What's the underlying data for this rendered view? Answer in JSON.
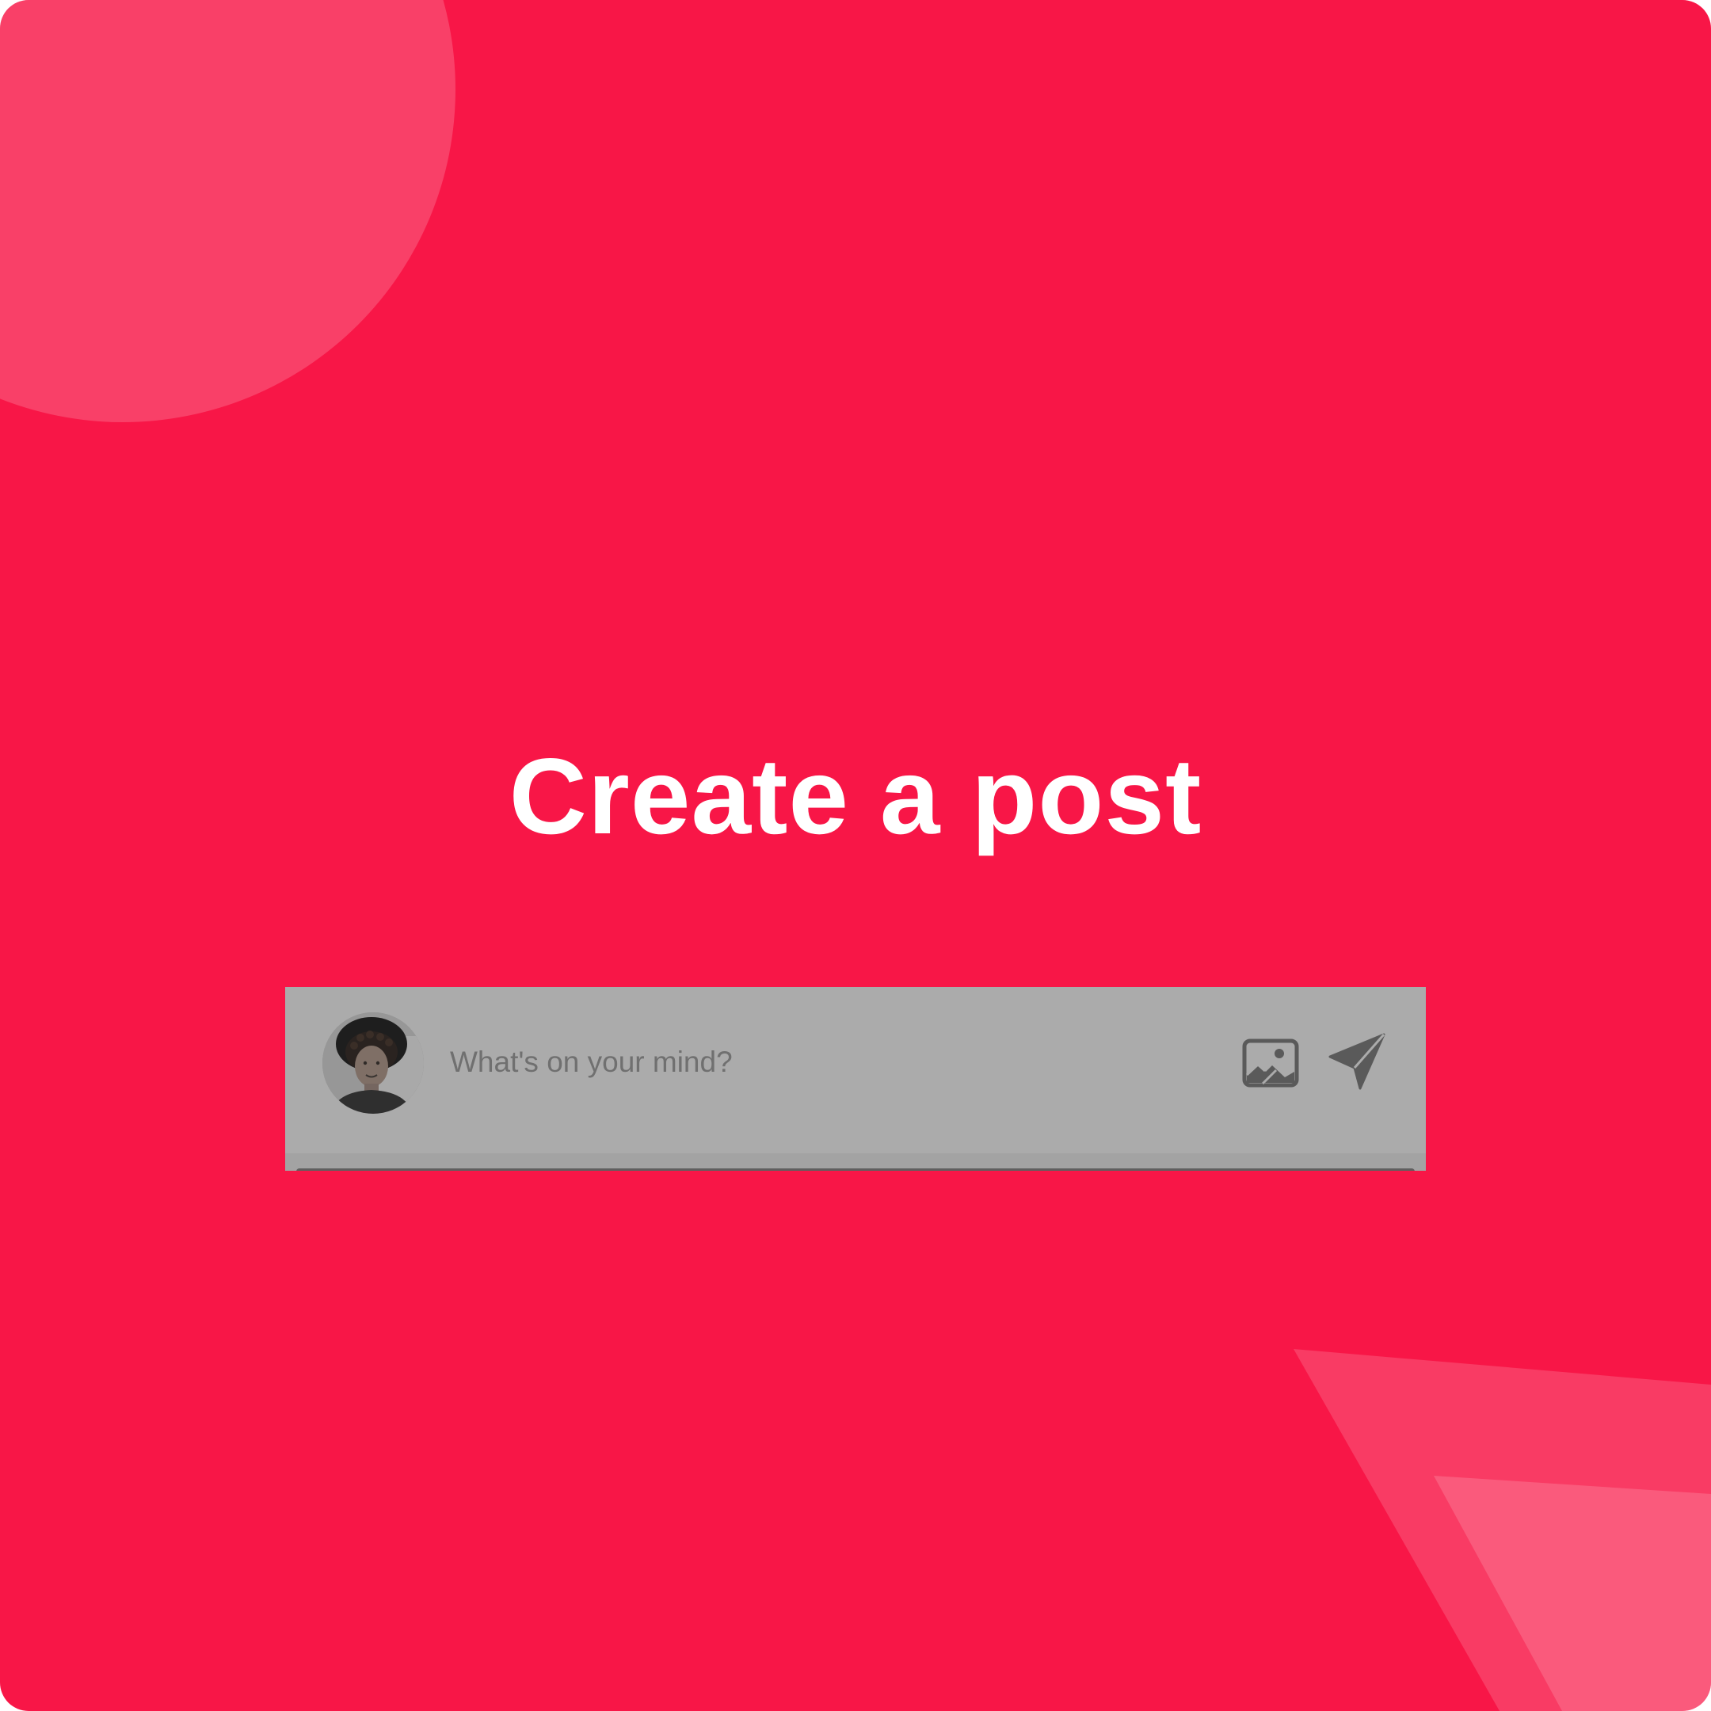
{
  "title": "Create a post",
  "composer": {
    "placeholder": "What's on your mind?",
    "avatar_alt": "User avatar",
    "actions": [
      {
        "name": "image-icon",
        "label": "Add image"
      },
      {
        "name": "send-icon",
        "label": "Send post"
      }
    ]
  },
  "colors": {
    "background": "#f81647",
    "decoration": "#ffffff",
    "title": "#ffffff",
    "composer_bg": "#ababab",
    "placeholder": "#707070",
    "icon": "#5a5a5a"
  }
}
